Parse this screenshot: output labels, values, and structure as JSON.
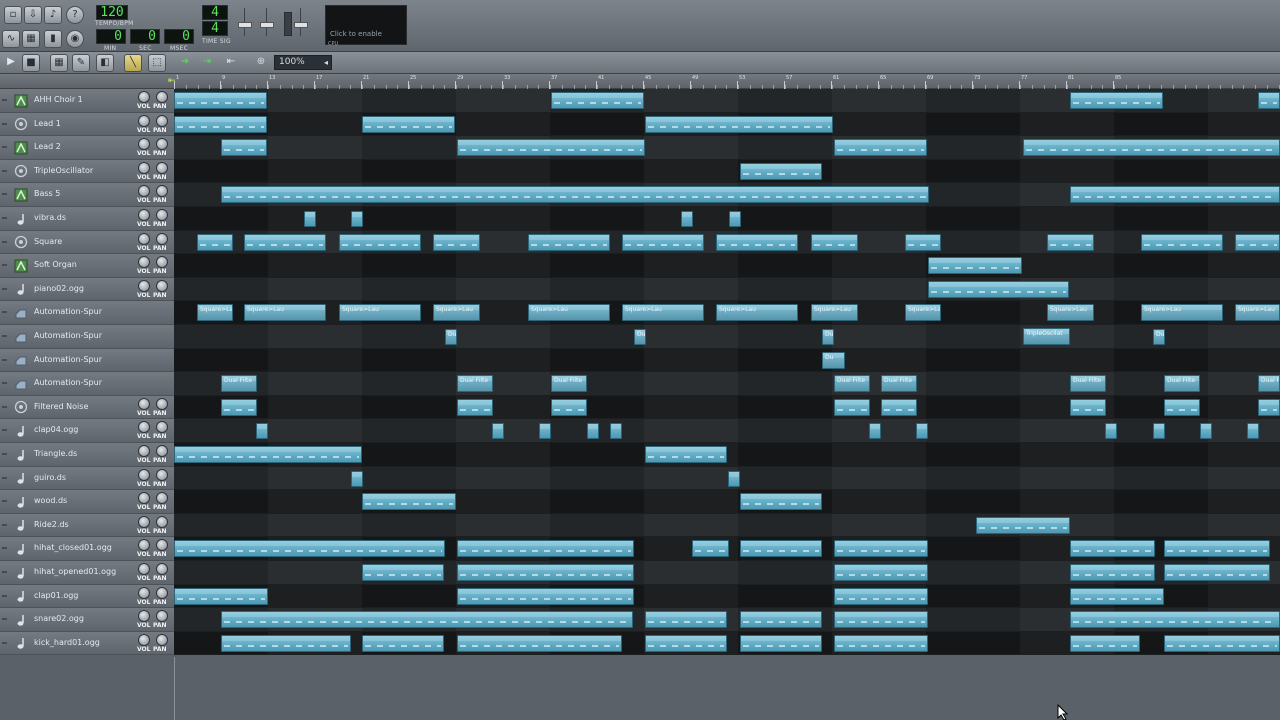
{
  "transport": {
    "tempo": "120",
    "tempo_label": "TEMPO/BPM",
    "min": "0",
    "sec": "0",
    "msec": "0",
    "min_label": "MIN",
    "sec_label": "SEC",
    "msec_label": "MSEC",
    "timesig_top": "4",
    "timesig_bottom": "4",
    "timesig_label": "TIME SIG",
    "cpu_hint": "Click to enable",
    "cpu_label": "CPU"
  },
  "editor": {
    "zoom": "100%"
  },
  "ruler": {
    "labels": [
      "1",
      "9",
      "13",
      "17",
      "21",
      "25",
      "29",
      "33",
      "37",
      "41",
      "45",
      "49",
      "53",
      "57",
      "61",
      "65",
      "69",
      "73",
      "77",
      "81",
      "85"
    ]
  },
  "tracks": [
    {
      "name": "AHH Choir 1",
      "type": "instrument",
      "knobs": true
    },
    {
      "name": "Lead 1",
      "type": "triple",
      "knobs": true
    },
    {
      "name": "Lead 2",
      "type": "instrument",
      "knobs": true
    },
    {
      "name": "TripleOscillator",
      "type": "triple",
      "knobs": true
    },
    {
      "name": "Bass 5",
      "type": "instrument",
      "knobs": true
    },
    {
      "name": "vibra.ds",
      "type": "sample",
      "knobs": true
    },
    {
      "name": "Square",
      "type": "triple",
      "knobs": true
    },
    {
      "name": "Soft Organ",
      "type": "instrument",
      "knobs": true
    },
    {
      "name": "piano02.ogg",
      "type": "sample",
      "knobs": true
    },
    {
      "name": "Automation-Spur",
      "type": "automation",
      "knobs": false
    },
    {
      "name": "Automation-Spur",
      "type": "automation",
      "knobs": false
    },
    {
      "name": "Automation-Spur",
      "type": "automation",
      "knobs": false
    },
    {
      "name": "Automation-Spur",
      "type": "automation",
      "knobs": false
    },
    {
      "name": "Filtered Noise",
      "type": "triple",
      "knobs": true
    },
    {
      "name": "clap04.ogg",
      "type": "sample",
      "knobs": true
    },
    {
      "name": "Triangle.ds",
      "type": "sample",
      "knobs": true
    },
    {
      "name": "guiro.ds",
      "type": "sample",
      "knobs": true
    },
    {
      "name": "wood.ds",
      "type": "sample",
      "knobs": true
    },
    {
      "name": "Ride2.ds",
      "type": "sample",
      "knobs": true
    },
    {
      "name": "hihat_closed01.ogg",
      "type": "sample",
      "knobs": true
    },
    {
      "name": "hihat_opened01.ogg",
      "type": "sample",
      "knobs": true
    },
    {
      "name": "clap01.ogg",
      "type": "sample",
      "knobs": true
    },
    {
      "name": "snare02.ogg",
      "type": "sample",
      "knobs": true
    },
    {
      "name": "kick_hard01.ogg",
      "type": "sample",
      "knobs": true
    }
  ],
  "knob_labels": {
    "vol": "VOL",
    "pan": "PAN"
  },
  "clip_labels": {
    "square": "Square>Lau",
    "dual": "Dual Filte",
    "dual_short": "Du",
    "triple": "TripleOscilat"
  }
}
